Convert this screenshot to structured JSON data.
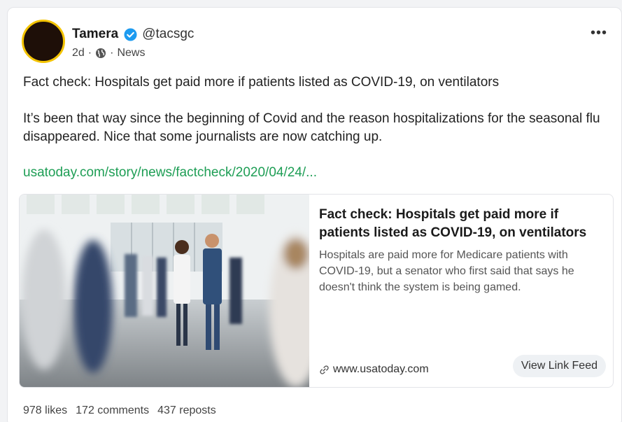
{
  "post": {
    "author_name": "Tamera",
    "author_handle": "@tacsgc",
    "age": "2d",
    "category": "News",
    "headline": "Fact check: Hospitals get paid more if patients listed as COVID-19, on ventilators",
    "comment": "It’s been that way since the beginning of Covid and the reason hospitalizations for the seasonal flu disappeared. Nice that some journalists are now catching up.",
    "link_text": "usatoday.com/story/news/factcheck/2020/04/24/...",
    "more_label": "•••"
  },
  "preview": {
    "title": "Fact check: Hospitals get paid more if patients listed as COVID-19, on ventilators",
    "description": "Hospitals are paid more for Medicare patients with COVID-19, but a senator who first said that says he doesn't think the system is being gamed.",
    "domain": "www.usatoday.com",
    "button_label": "View Link Feed"
  },
  "stats": {
    "likes": "978 likes",
    "comments": "172 comments",
    "reposts": "437 reposts"
  },
  "colors": {
    "link": "#1e9e55",
    "verified": "#1d9bf0",
    "avatar_ring": "#f3c300"
  },
  "icons": [
    "verified-badge-icon",
    "globe-icon",
    "more-options-icon",
    "link-chain-icon"
  ]
}
